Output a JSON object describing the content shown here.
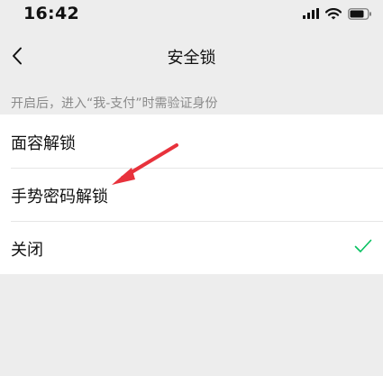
{
  "status_bar": {
    "time": "16:42",
    "icons": [
      "signal-icon",
      "wifi-icon",
      "battery-icon"
    ]
  },
  "nav": {
    "title": "安全锁",
    "back_icon": "chevron-left-icon"
  },
  "hint": "开启后，进入“我-支付”时需验证身份",
  "options": [
    {
      "label": "面容解锁",
      "selected": false
    },
    {
      "label": "手势密码解锁",
      "selected": false
    },
    {
      "label": "关闭",
      "selected": true
    }
  ],
  "colors": {
    "background": "#ededed",
    "list_background": "#ffffff",
    "check": "#07c160",
    "annotation_arrow": "#e8323c"
  }
}
